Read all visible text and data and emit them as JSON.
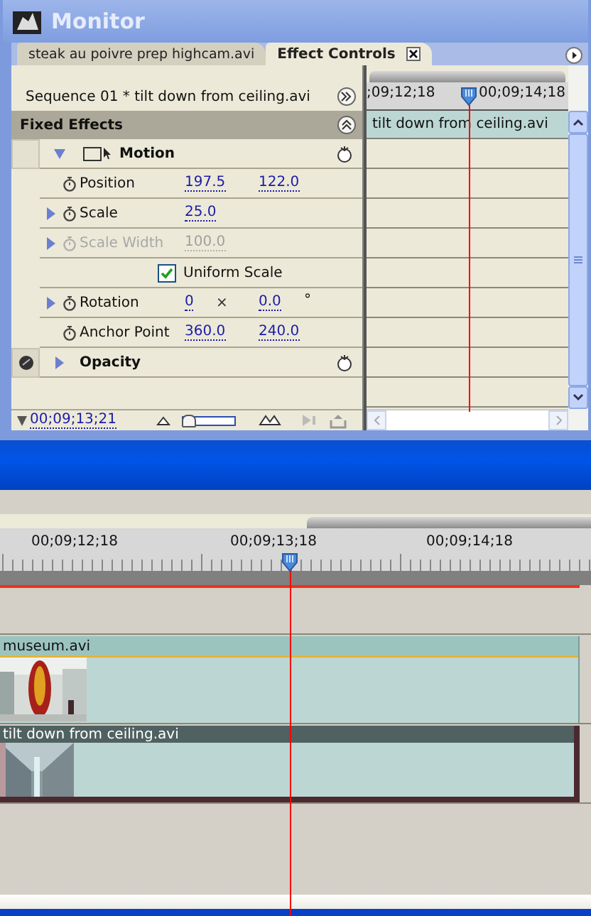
{
  "window": {
    "title": "Monitor"
  },
  "tabs": [
    {
      "label": "steak au poivre prep highcam.avi",
      "selected": false,
      "closable": false
    },
    {
      "label": "Effect Controls",
      "selected": true,
      "closable": true
    }
  ],
  "effect_controls": {
    "sequence_label": "Sequence 01 * tilt down from ceiling.avi",
    "section_title": "Fixed Effects",
    "effects": [
      {
        "name": "Motion",
        "expanded": true,
        "fx_icon": false,
        "properties": [
          {
            "kind": "value",
            "name": "Position",
            "values": [
              "197.5",
              "122.0"
            ],
            "expander": false,
            "disabled": false
          },
          {
            "kind": "value",
            "name": "Scale",
            "values": [
              "25.0"
            ],
            "expander": true,
            "disabled": false
          },
          {
            "kind": "value",
            "name": "Scale Width",
            "values": [
              "100.0"
            ],
            "expander": true,
            "disabled": true
          },
          {
            "kind": "checkbox",
            "name": "Uniform Scale",
            "checked": true
          },
          {
            "kind": "value",
            "name": "Rotation",
            "values": [
              "0",
              "0.0"
            ],
            "separator": "×",
            "unit": "°",
            "expander": true,
            "disabled": false
          },
          {
            "kind": "value",
            "name": "Anchor Point",
            "values": [
              "360.0",
              "240.0"
            ],
            "expander": false,
            "disabled": false
          }
        ]
      },
      {
        "name": "Opacity",
        "expanded": false,
        "fx_icon": true
      }
    ],
    "current_time": "00;09;13;21",
    "zoom": {
      "level": 0.1
    }
  },
  "mini_timeline": {
    "timecodes": [
      ";09;12;18",
      "00;09;14;18"
    ],
    "clip": "tilt down from ceiling.avi"
  },
  "timeline": {
    "timecodes": [
      "00;09;12;18",
      "00;09;13;18",
      "00;09;14;18"
    ],
    "tracks": [
      {
        "clip": "museum.avi",
        "selected": false
      },
      {
        "clip": "tilt down from ceiling.avi",
        "selected": true
      }
    ]
  }
}
